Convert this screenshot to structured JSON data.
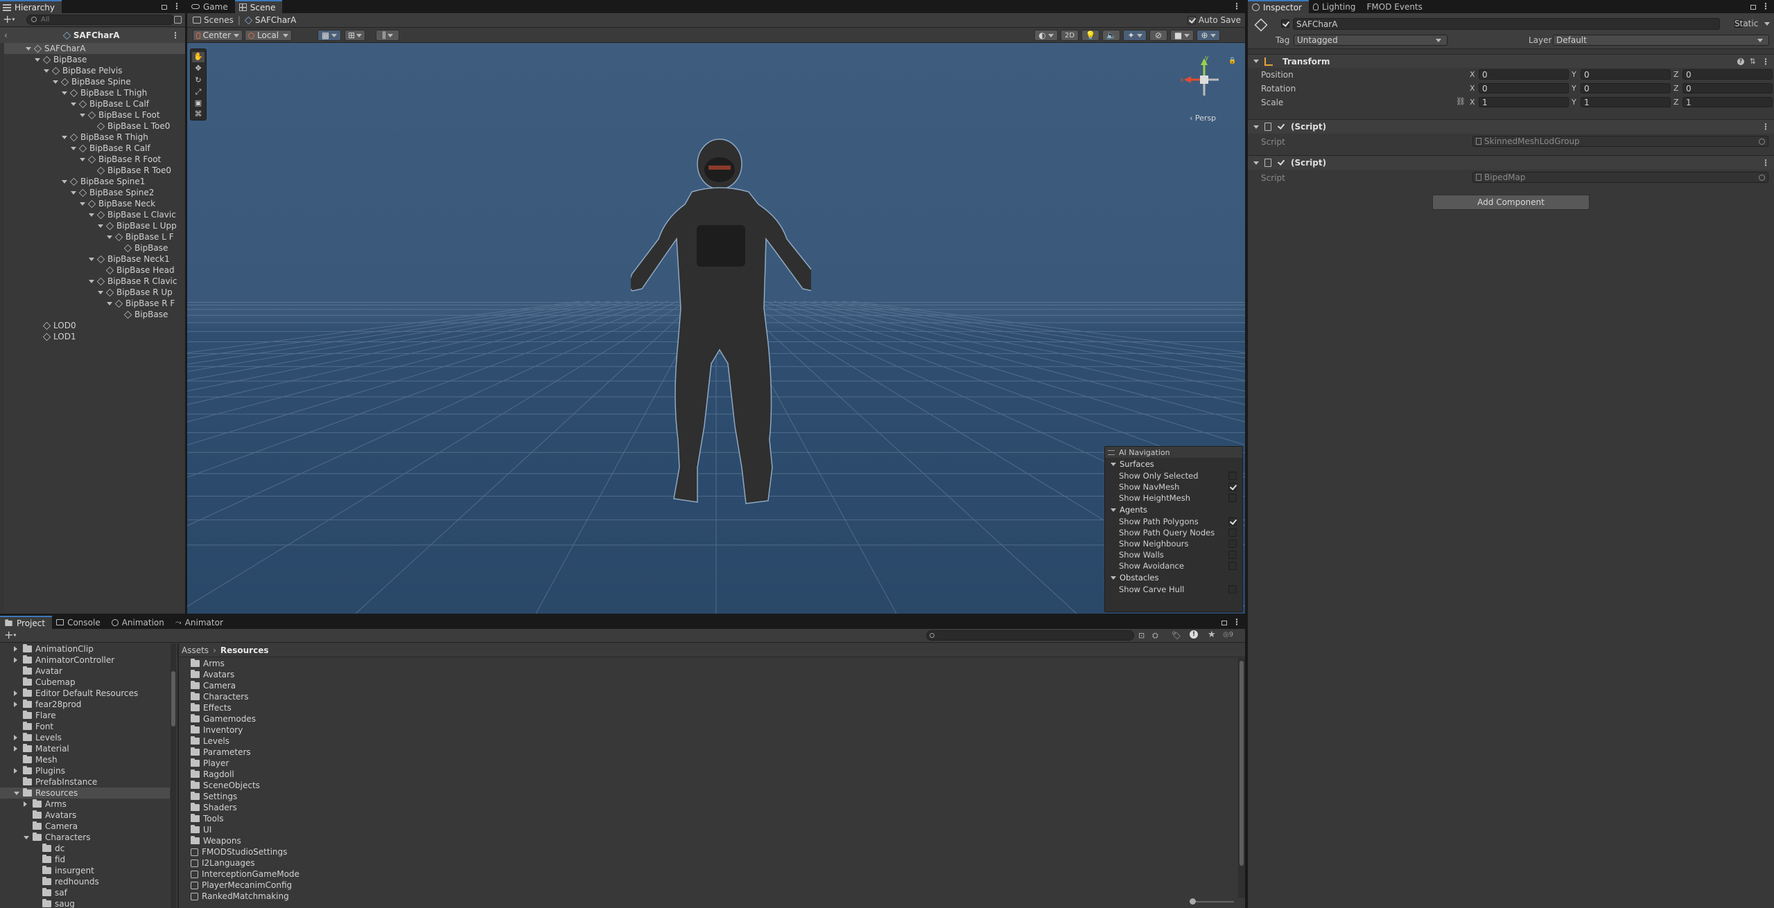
{
  "hierarchy": {
    "tab_label": "Hierarchy",
    "search_placeholder": "All",
    "scene_root": "SAFCharA",
    "items": [
      {
        "label": "SAFCharA",
        "depth": 1,
        "expanded": true,
        "selected": true
      },
      {
        "label": "BipBase",
        "depth": 2,
        "expanded": true
      },
      {
        "label": "BipBase Pelvis",
        "depth": 3,
        "expanded": true
      },
      {
        "label": "BipBase Spine",
        "depth": 4,
        "expanded": true
      },
      {
        "label": "BipBase L Thigh",
        "depth": 5,
        "expanded": true
      },
      {
        "label": "BipBase L Calf",
        "depth": 6,
        "expanded": true
      },
      {
        "label": "BipBase L Foot",
        "depth": 7,
        "expanded": true
      },
      {
        "label": "BipBase L Toe0",
        "depth": 8,
        "expanded": false
      },
      {
        "label": "BipBase R Thigh",
        "depth": 5,
        "expanded": true
      },
      {
        "label": "BipBase R Calf",
        "depth": 6,
        "expanded": true
      },
      {
        "label": "BipBase R Foot",
        "depth": 7,
        "expanded": true
      },
      {
        "label": "BipBase R Toe0",
        "depth": 8,
        "expanded": false
      },
      {
        "label": "BipBase Spine1",
        "depth": 5,
        "expanded": true
      },
      {
        "label": "BipBase Spine2",
        "depth": 6,
        "expanded": true
      },
      {
        "label": "BipBase Neck",
        "depth": 7,
        "expanded": true
      },
      {
        "label": "BipBase L Clavic",
        "depth": 8,
        "expanded": true
      },
      {
        "label": "BipBase L Upp",
        "depth": 9,
        "expanded": true
      },
      {
        "label": "BipBase L F",
        "depth": 10,
        "expanded": true
      },
      {
        "label": "BipBase",
        "depth": 11,
        "expanded": false
      },
      {
        "label": "BipBase Neck1",
        "depth": 8,
        "expanded": true
      },
      {
        "label": "BipBase Head",
        "depth": 9,
        "expanded": false
      },
      {
        "label": "BipBase R Clavic",
        "depth": 8,
        "expanded": true
      },
      {
        "label": "BipBase R Up",
        "depth": 9,
        "expanded": true
      },
      {
        "label": "BipBase R F",
        "depth": 10,
        "expanded": true
      },
      {
        "label": "BipBase",
        "depth": 11,
        "expanded": false
      },
      {
        "label": "LOD0",
        "depth": 2,
        "expanded": false
      },
      {
        "label": "LOD1",
        "depth": 2,
        "expanded": false
      }
    ]
  },
  "viewtabs": {
    "game": "Game",
    "scene": "Scene"
  },
  "scene": {
    "breadcrumb_root": "Scenes",
    "breadcrumb_current": "SAFCharA",
    "auto_save_label": "Auto Save",
    "auto_save_checked": true,
    "pivot_label": "Center",
    "space_label": "Local",
    "mode_2d": "2D",
    "persp_label": "Persp",
    "gizmo_x": "x",
    "gizmo_y": "y"
  },
  "ai_navigation": {
    "title": "AI Navigation",
    "sections": [
      {
        "name": "Surfaces",
        "items": [
          {
            "label": "Show Only Selected",
            "checked": false
          },
          {
            "label": "Show NavMesh",
            "checked": true
          },
          {
            "label": "Show HeightMesh",
            "checked": false
          }
        ]
      },
      {
        "name": "Agents",
        "items": [
          {
            "label": "Show Path Polygons",
            "checked": true
          },
          {
            "label": "Show Path Query Nodes",
            "checked": false
          },
          {
            "label": "Show Neighbours",
            "checked": false
          },
          {
            "label": "Show Walls",
            "checked": false
          },
          {
            "label": "Show Avoidance",
            "checked": false
          }
        ]
      },
      {
        "name": "Obstacles",
        "items": [
          {
            "label": "Show Carve Hull",
            "checked": false
          }
        ]
      }
    ]
  },
  "inspector": {
    "tabs": [
      "Inspector",
      "Lighting",
      "FMOD Events"
    ],
    "object_name": "SAFCharA",
    "static_label": "Static",
    "tag_label": "Tag",
    "tag_value": "Untagged",
    "layer_label": "Layer",
    "layer_value": "Default",
    "transform": {
      "title": "Transform",
      "rows": [
        {
          "label": "Position",
          "x": "0",
          "y": "0",
          "z": "0"
        },
        {
          "label": "Rotation",
          "x": "0",
          "y": "0",
          "z": "0"
        },
        {
          "label": "Scale",
          "x": "1",
          "y": "1",
          "z": "1"
        }
      ],
      "axis_x": "X",
      "axis_y": "Y",
      "axis_z": "Z"
    },
    "scripts": [
      {
        "title": "(Script)",
        "field_label": "Script",
        "value": "SkinnedMeshLodGroup"
      },
      {
        "title": "(Script)",
        "field_label": "Script",
        "value": "BipedMap"
      }
    ],
    "add_component": "Add Component"
  },
  "bottom": {
    "tabs": [
      "Project",
      "Console",
      "Animation",
      "Animator"
    ],
    "visible_count": "9",
    "breadcrumb": [
      "Assets",
      "Resources"
    ],
    "tree": [
      {
        "label": "AnimationClip",
        "depth": 1,
        "arrow": "right"
      },
      {
        "label": "AnimatorController",
        "depth": 1,
        "arrow": "right"
      },
      {
        "label": "Avatar",
        "depth": 1,
        "arrow": "none"
      },
      {
        "label": "Cubemap",
        "depth": 1,
        "arrow": "none"
      },
      {
        "label": "Editor Default Resources",
        "depth": 1,
        "arrow": "right"
      },
      {
        "label": "fear28prod",
        "depth": 1,
        "arrow": "right"
      },
      {
        "label": "Flare",
        "depth": 1,
        "arrow": "none"
      },
      {
        "label": "Font",
        "depth": 1,
        "arrow": "none"
      },
      {
        "label": "Levels",
        "depth": 1,
        "arrow": "right"
      },
      {
        "label": "Material",
        "depth": 1,
        "arrow": "right"
      },
      {
        "label": "Mesh",
        "depth": 1,
        "arrow": "none"
      },
      {
        "label": "Plugins",
        "depth": 1,
        "arrow": "right"
      },
      {
        "label": "PrefabInstance",
        "depth": 1,
        "arrow": "none"
      },
      {
        "label": "Resources",
        "depth": 1,
        "arrow": "down",
        "selected": true
      },
      {
        "label": "Arms",
        "depth": 2,
        "arrow": "right"
      },
      {
        "label": "Avatars",
        "depth": 2,
        "arrow": "none"
      },
      {
        "label": "Camera",
        "depth": 2,
        "arrow": "none"
      },
      {
        "label": "Characters",
        "depth": 2,
        "arrow": "down"
      },
      {
        "label": "dc",
        "depth": 3,
        "arrow": "none"
      },
      {
        "label": "fid",
        "depth": 3,
        "arrow": "none"
      },
      {
        "label": "insurgent",
        "depth": 3,
        "arrow": "none"
      },
      {
        "label": "redhounds",
        "depth": 3,
        "arrow": "none"
      },
      {
        "label": "saf",
        "depth": 3,
        "arrow": "none"
      },
      {
        "label": "saug",
        "depth": 3,
        "arrow": "none"
      }
    ],
    "assets": [
      {
        "label": "Arms",
        "kind": "folder"
      },
      {
        "label": "Avatars",
        "kind": "folder"
      },
      {
        "label": "Camera",
        "kind": "folder"
      },
      {
        "label": "Characters",
        "kind": "folder"
      },
      {
        "label": "Effects",
        "kind": "folder"
      },
      {
        "label": "Gamemodes",
        "kind": "folder"
      },
      {
        "label": "Inventory",
        "kind": "folder"
      },
      {
        "label": "Levels",
        "kind": "folder"
      },
      {
        "label": "Parameters",
        "kind": "folder"
      },
      {
        "label": "Player",
        "kind": "folder"
      },
      {
        "label": "Ragdoll",
        "kind": "folder"
      },
      {
        "label": "SceneObjects",
        "kind": "folder"
      },
      {
        "label": "Settings",
        "kind": "folder"
      },
      {
        "label": "Shaders",
        "kind": "folder"
      },
      {
        "label": "Tools",
        "kind": "folder"
      },
      {
        "label": "UI",
        "kind": "folder"
      },
      {
        "label": "Weapons",
        "kind": "folder"
      },
      {
        "label": "FMODStudioSettings",
        "kind": "asset"
      },
      {
        "label": "I2Languages",
        "kind": "asset"
      },
      {
        "label": "InterceptionGameMode",
        "kind": "asset"
      },
      {
        "label": "PlayerMecanimConfig",
        "kind": "asset"
      },
      {
        "label": "RankedMatchmaking",
        "kind": "asset"
      }
    ]
  },
  "colors": {
    "scene_sky": "#3a5a7c",
    "scene_ground": "#2d4c6e",
    "selection": "#4d4d4d",
    "accent": "#3a79bb"
  }
}
